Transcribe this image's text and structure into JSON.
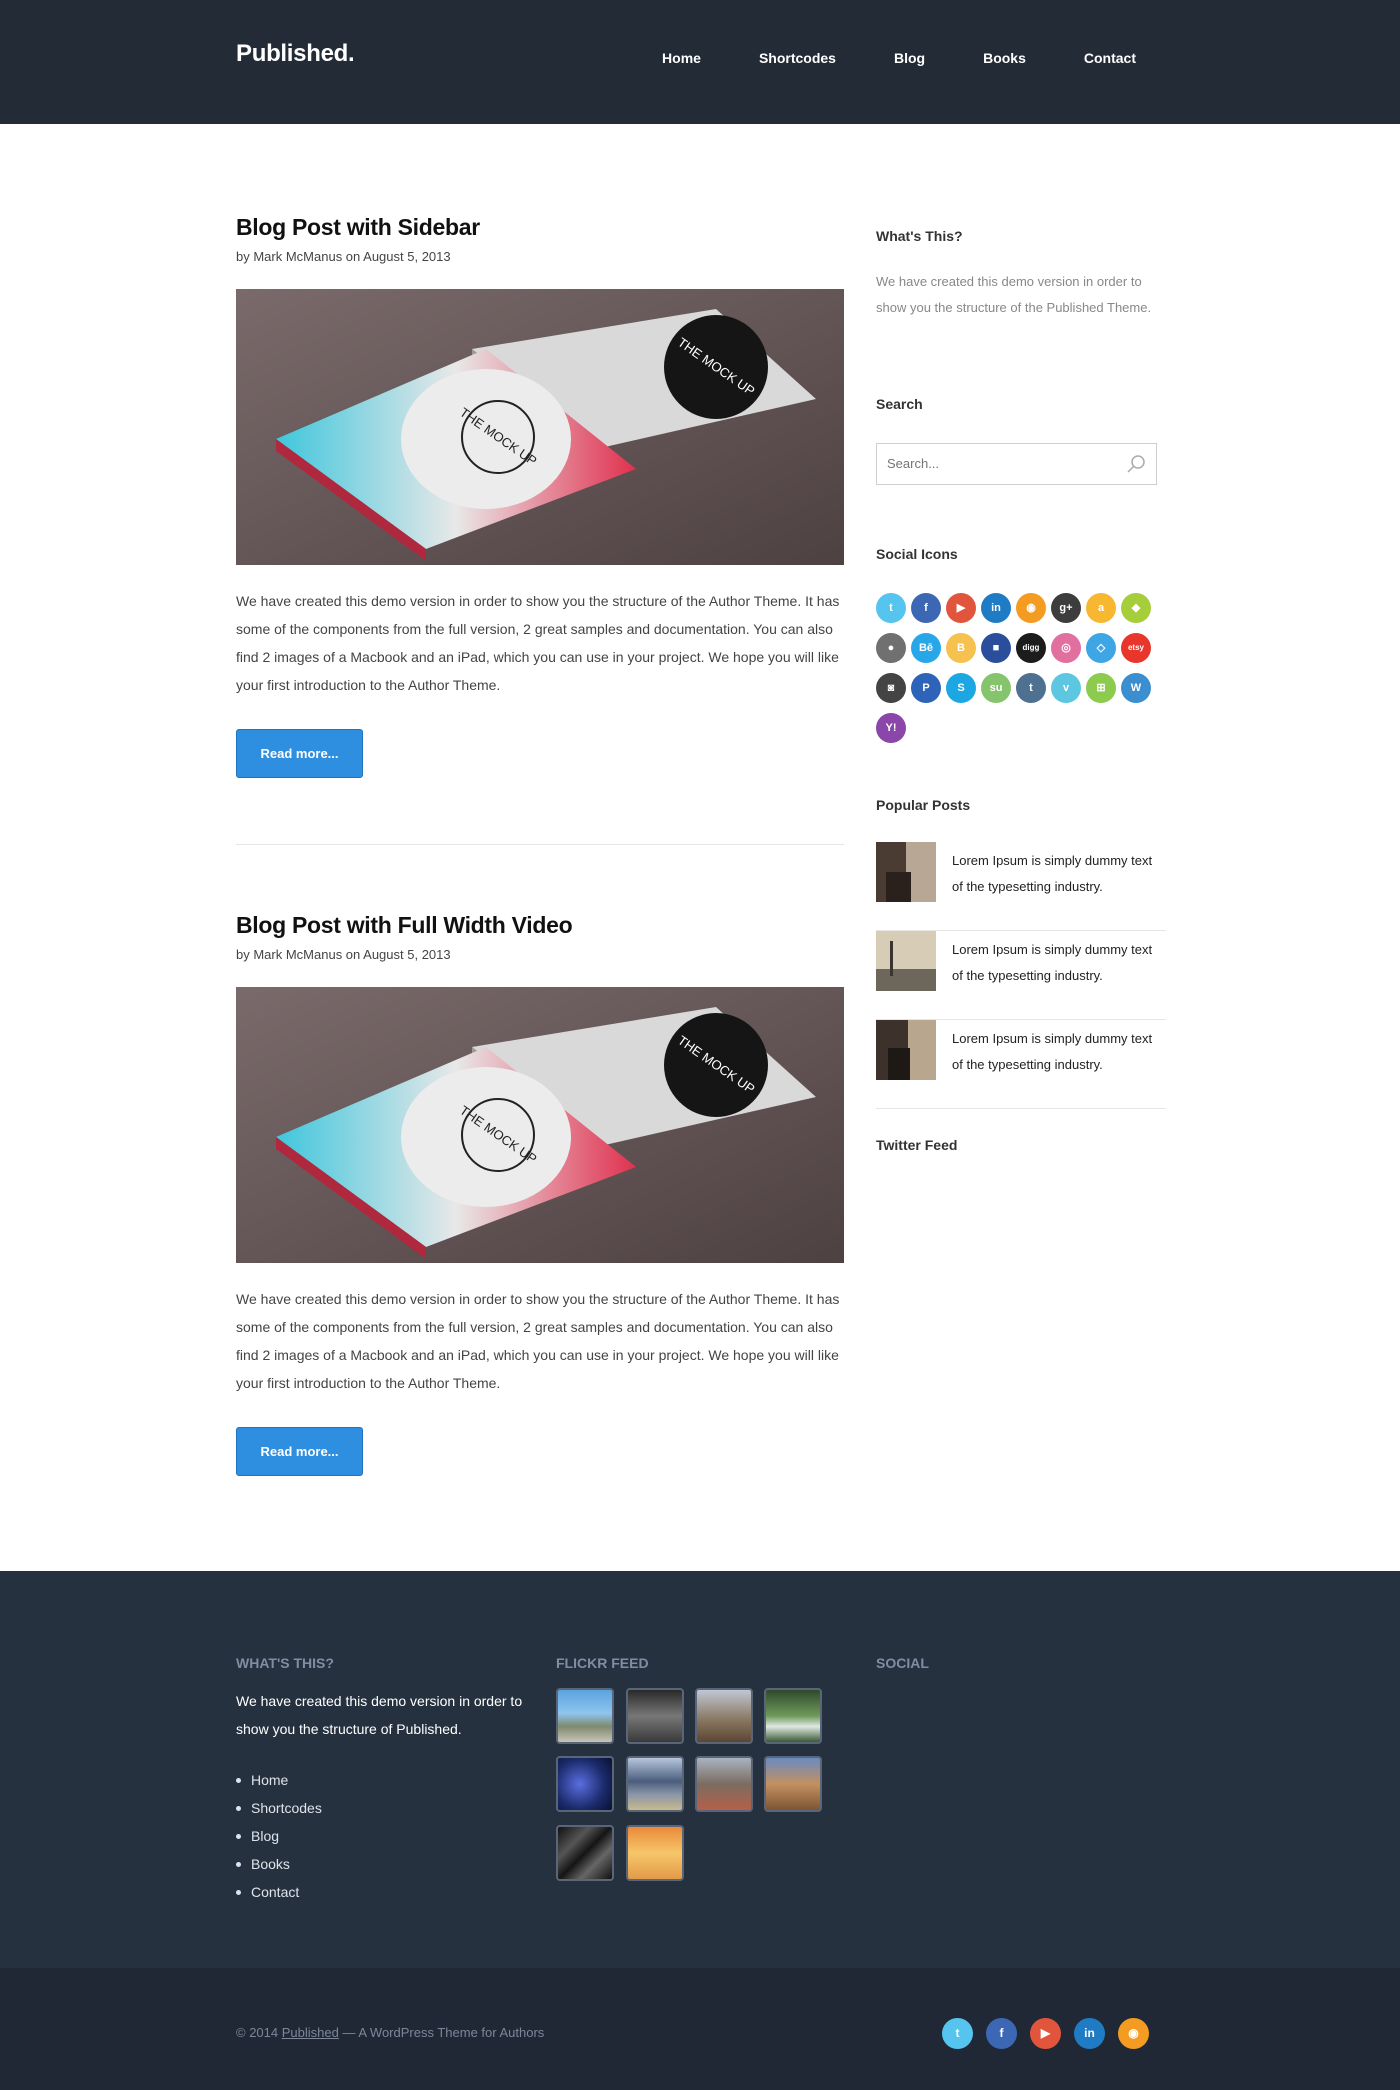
{
  "header": {
    "logo": "Published.",
    "nav": [
      "Home",
      "Shortcodes",
      "Blog",
      "Books",
      "Contact"
    ]
  },
  "posts": [
    {
      "title": "Blog Post with Sidebar",
      "meta_by": "by Mark McManus on August 5, 2013",
      "image_card_text": "THE MOCK UP",
      "text": "We have created this demo version in order to show you the structure of the Author Theme. It has some of the components from the full version, 2 great samples and documentation. You can also find 2 images of a Macbook and an iPad, which you can use in your project. We hope you will like your first introduction to the Author Theme.",
      "button": "Read more..."
    },
    {
      "title": "Blog Post with Full Width Video",
      "meta_by": "by Mark McManus on August 5, 2013",
      "image_card_text": "THE MOCK UP",
      "text": "We have created this demo version in order to show you the structure of the Author Theme. It has some of the components from the full version, 2 great samples and documentation. You can also find 2 images of a Macbook and an iPad, which you can use in your project. We hope you will like your first introduction to the Author Theme.",
      "button": "Read more..."
    }
  ],
  "sidebar": {
    "whats_this_title": "What's This?",
    "whats_this_text": "We have created this demo version in order to show you the structure of the Published Theme.",
    "search_title": "Search",
    "search_placeholder": "Search...",
    "social_title": "Social Icons",
    "social_icons": [
      {
        "name": "twitter-icon",
        "glyph": "t",
        "color": "#55c5ef"
      },
      {
        "name": "facebook-icon",
        "glyph": "f",
        "color": "#3b67b5"
      },
      {
        "name": "youtube-icon",
        "glyph": "▶",
        "color": "#e2553d"
      },
      {
        "name": "linkedin-icon",
        "glyph": "in",
        "color": "#1e7bc4"
      },
      {
        "name": "rss-icon",
        "glyph": "◉",
        "color": "#f39c21"
      },
      {
        "name": "google-plus-icon",
        "glyph": "g+",
        "color": "#3d3d3d"
      },
      {
        "name": "amazon-icon",
        "glyph": "a",
        "color": "#f7b731"
      },
      {
        "name": "android-icon",
        "glyph": "◆",
        "color": "#a5ce3a"
      },
      {
        "name": "apple-icon",
        "glyph": "●",
        "color": "#707070"
      },
      {
        "name": "behance-icon",
        "glyph": "Bē",
        "color": "#28a7e8"
      },
      {
        "name": "blogger-icon",
        "glyph": "B",
        "color": "#f7c150"
      },
      {
        "name": "delicious-icon",
        "glyph": "■",
        "color": "#2a4e9b"
      },
      {
        "name": "digg-icon",
        "glyph": "digg",
        "color": "#1c1c1c"
      },
      {
        "name": "dribbble-icon",
        "glyph": "◎",
        "color": "#e16fa0"
      },
      {
        "name": "dropbox-icon",
        "glyph": "◇",
        "color": "#3fa6e6"
      },
      {
        "name": "etsy-icon",
        "glyph": "etsy",
        "color": "#e8362c"
      },
      {
        "name": "instagram-icon",
        "glyph": "◙",
        "color": "#444444"
      },
      {
        "name": "paypal-icon",
        "glyph": "P",
        "color": "#2d63b8"
      },
      {
        "name": "skype-icon",
        "glyph": "S",
        "color": "#1da7e2"
      },
      {
        "name": "stumbleupon-icon",
        "glyph": "su",
        "color": "#85c36c"
      },
      {
        "name": "tumblr-icon",
        "glyph": "t",
        "color": "#4e7192"
      },
      {
        "name": "vimeo-icon",
        "glyph": "v",
        "color": "#5dc6e0"
      },
      {
        "name": "windows-icon",
        "glyph": "⊞",
        "color": "#8ccb4e"
      },
      {
        "name": "wordpress-icon",
        "glyph": "W",
        "color": "#3b8fd0"
      },
      {
        "name": "yahoo-icon",
        "glyph": "Y!",
        "color": "#8a46a8"
      }
    ],
    "popular_title": "Popular Posts",
    "popular_posts": [
      "Lorem Ipsum is simply dummy text of the typesetting industry.",
      "Lorem Ipsum is simply dummy text of the typesetting industry.",
      "Lorem Ipsum is simply dummy text of the typesetting industry."
    ],
    "twitter_title": "Twitter Feed"
  },
  "footer": {
    "col1_title": "WHAT'S THIS?",
    "col1_text": "We have created this demo version in order to show you the structure of Published.",
    "links": [
      "Home",
      "Shortcodes",
      "Blog",
      "Books",
      "Contact"
    ],
    "col2_title": "FLICKR FEED",
    "col3_title": "SOCIAL",
    "copyright_prefix": "© 2014 ",
    "copyright_brand": "Published",
    "copyright_suffix": " — A WordPress Theme for Authors",
    "bottom_social": [
      {
        "name": "twitter-icon",
        "glyph": "t",
        "color": "#55c5ef"
      },
      {
        "name": "facebook-icon",
        "glyph": "f",
        "color": "#3b67b5"
      },
      {
        "name": "youtube-icon",
        "glyph": "▶",
        "color": "#e2553d"
      },
      {
        "name": "linkedin-icon",
        "glyph": "in",
        "color": "#1e7bc4"
      },
      {
        "name": "rss-icon",
        "glyph": "◉",
        "color": "#f39c21"
      }
    ]
  }
}
